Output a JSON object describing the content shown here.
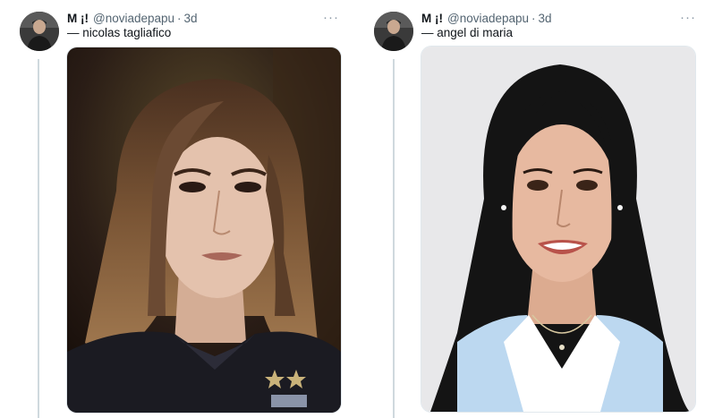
{
  "tweets": [
    {
      "name": "M ¡!",
      "handle": "@noviadepapu",
      "separator": "·",
      "time": "3d",
      "more": "···",
      "text": "— nicolas tagliafico",
      "colors": {
        "bg_dark": "#2a1d16",
        "hair": "#6b4a33",
        "skin": "#e4c2ad",
        "shirt": "#1b1b22"
      }
    },
    {
      "name": "M ¡!",
      "handle": "@noviadepapu",
      "separator": "·",
      "time": "3d",
      "more": "···",
      "text": "— angel di maria",
      "colors": {
        "bg_light": "#e8e8ea",
        "hair": "#141414",
        "skin": "#e7b9a0",
        "shirt": "#bcd8f0"
      }
    }
  ]
}
